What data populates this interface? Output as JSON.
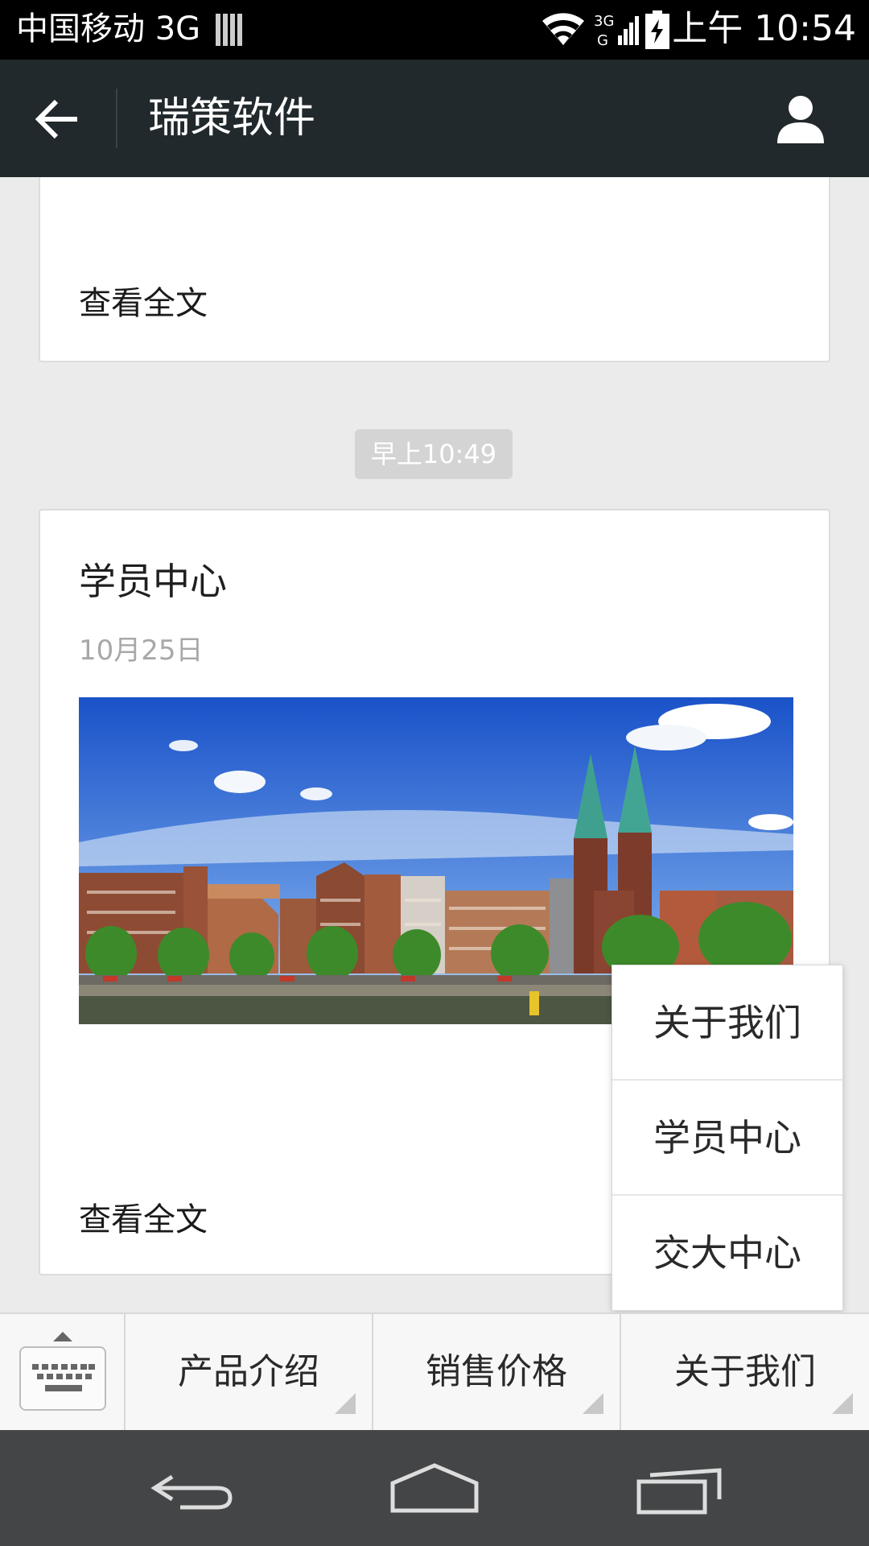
{
  "status_bar": {
    "carrier": "中国移动 3G",
    "net_label": "3G",
    "time": "上午 10:54",
    "icons": [
      "signal-bars-icon",
      "wifi-icon",
      "network-3g-icon",
      "battery-charging-icon"
    ]
  },
  "header": {
    "title": "瑞策软件",
    "back_icon": "back-arrow-icon",
    "profile_icon": "profile-icon"
  },
  "content": {
    "top_card": {
      "read_more": "查看全文"
    },
    "time_chip": "早上10:49",
    "main_card": {
      "title": "学员中心",
      "date": "10月25日",
      "image": "cityscape-photo",
      "read_more": "查看全文"
    }
  },
  "popup_menu": {
    "items": [
      "关于我们",
      "学员中心",
      "交大中心"
    ]
  },
  "menu_bar": {
    "keyboard_icon": "keyboard-icon",
    "tabs": [
      "产品介绍",
      "销售价格",
      "关于我们"
    ]
  },
  "nav_bar": {
    "icons": [
      "nav-back-icon",
      "nav-home-icon",
      "nav-recents-icon"
    ]
  },
  "colors": {
    "header_bg": "#22292c",
    "content_bg": "#ebebeb",
    "nav_bg": "#444546"
  }
}
